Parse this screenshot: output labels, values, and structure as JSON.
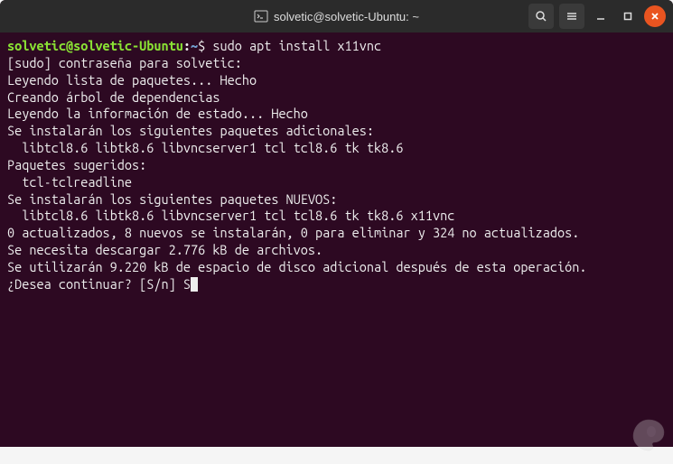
{
  "titlebar": {
    "title": "solvetic@solvetic-Ubuntu: ~"
  },
  "prompt": {
    "user_host": "solvetic@solvetic-Ubuntu",
    "path": "~",
    "symbol": "$"
  },
  "command": "sudo apt install x11vnc",
  "output": {
    "l1": "[sudo] contraseña para solvetic:",
    "l2": "Leyendo lista de paquetes... Hecho",
    "l3": "Creando árbol de dependencias",
    "l4": "Leyendo la información de estado... Hecho",
    "l5": "Se instalarán los siguientes paquetes adicionales:",
    "l6": "  libtcl8.6 libtk8.6 libvncserver1 tcl tcl8.6 tk tk8.6",
    "l7": "Paquetes sugeridos:",
    "l8": "  tcl-tclreadline",
    "l9": "Se instalarán los siguientes paquetes NUEVOS:",
    "l10": "  libtcl8.6 libtk8.6 libvncserver1 tcl tcl8.6 tk tk8.6 x11vnc",
    "l11": "0 actualizados, 8 nuevos se instalarán, 0 para eliminar y 324 no actualizados.",
    "l12": "Se necesita descargar 2.776 kB de archivos.",
    "l13": "Se utilizarán 9.220 kB de espacio de disco adicional después de esta operación.",
    "l14": "¿Desea continuar? [S/n] S"
  }
}
